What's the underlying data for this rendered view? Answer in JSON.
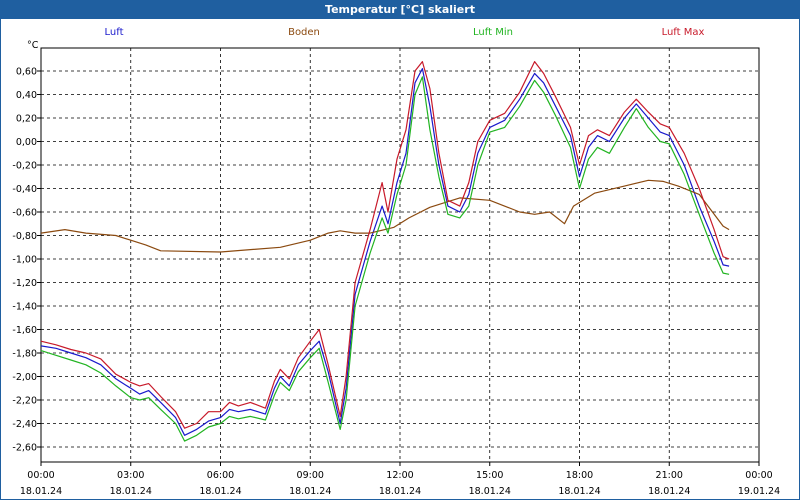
{
  "window": {
    "title": "Temperatur [°C] skaliert"
  },
  "chart_data": {
    "type": "line",
    "title": "Temperatur [°C] skaliert",
    "ylabel": "°C",
    "ylim": [
      -2.75,
      0.8
    ],
    "y_ticks": [
      "0,60",
      "0,40",
      "0,20",
      "0,00",
      "-0,20",
      "-0,40",
      "-0,60",
      "-0,80",
      "-1,00",
      "-1,20",
      "-1,40",
      "-1,60",
      "-1,80",
      "-2,00",
      "-2,20",
      "-2,40",
      "-2,60"
    ],
    "y_tick_values": [
      0.6,
      0.4,
      0.2,
      0,
      -0.2,
      -0.4,
      -0.6,
      -0.8,
      -1.0,
      -1.2,
      -1.4,
      -1.6,
      -1.8,
      -2.0,
      -2.2,
      -2.4,
      -2.6
    ],
    "x_ticks": [
      {
        "time": "00:00",
        "date": "18.01.24",
        "hour": 0
      },
      {
        "time": "03:00",
        "date": "18.01.24",
        "hour": 3
      },
      {
        "time": "06:00",
        "date": "18.01.24",
        "hour": 6
      },
      {
        "time": "09:00",
        "date": "18.01.24",
        "hour": 9
      },
      {
        "time": "12:00",
        "date": "18.01.24",
        "hour": 12
      },
      {
        "time": "15:00",
        "date": "18.01.24",
        "hour": 15
      },
      {
        "time": "18:00",
        "date": "18.01.24",
        "hour": 18
      },
      {
        "time": "21:00",
        "date": "18.01.24",
        "hour": 21
      },
      {
        "time": "00:00",
        "date": "19.01.24",
        "hour": 24
      }
    ],
    "x_range_hours": [
      0,
      24
    ],
    "grid": true,
    "legend_position": "top",
    "series": [
      {
        "name": "Luft",
        "color": "#1a1acc",
        "points": [
          [
            0,
            -1.74
          ],
          [
            0.5,
            -1.76
          ],
          [
            1,
            -1.8
          ],
          [
            1.5,
            -1.84
          ],
          [
            2,
            -1.9
          ],
          [
            2.5,
            -2.02
          ],
          [
            3,
            -2.1
          ],
          [
            3.3,
            -2.15
          ],
          [
            3.6,
            -2.12
          ],
          [
            4,
            -2.22
          ],
          [
            4.5,
            -2.35
          ],
          [
            4.8,
            -2.5
          ],
          [
            5.2,
            -2.45
          ],
          [
            5.6,
            -2.38
          ],
          [
            6,
            -2.35
          ],
          [
            6.3,
            -2.28
          ],
          [
            6.6,
            -2.3
          ],
          [
            7,
            -2.28
          ],
          [
            7.5,
            -2.32
          ],
          [
            7.8,
            -2.1
          ],
          [
            8,
            -2.0
          ],
          [
            8.3,
            -2.08
          ],
          [
            8.6,
            -1.9
          ],
          [
            9,
            -1.78
          ],
          [
            9.3,
            -1.7
          ],
          [
            9.6,
            -1.96
          ],
          [
            10,
            -2.4
          ],
          [
            10.2,
            -2.1
          ],
          [
            10.5,
            -1.3
          ],
          [
            11,
            -0.85
          ],
          [
            11.4,
            -0.55
          ],
          [
            11.6,
            -0.7
          ],
          [
            11.9,
            -0.35
          ],
          [
            12.2,
            -0.1
          ],
          [
            12.5,
            0.5
          ],
          [
            12.75,
            0.62
          ],
          [
            13,
            0.3
          ],
          [
            13.3,
            -0.2
          ],
          [
            13.6,
            -0.55
          ],
          [
            14,
            -0.6
          ],
          [
            14.3,
            -0.45
          ],
          [
            14.6,
            -0.1
          ],
          [
            15,
            0.12
          ],
          [
            15.5,
            0.18
          ],
          [
            16,
            0.36
          ],
          [
            16.5,
            0.58
          ],
          [
            16.8,
            0.5
          ],
          [
            17.2,
            0.3
          ],
          [
            17.7,
            0.05
          ],
          [
            18,
            -0.3
          ],
          [
            18.3,
            -0.05
          ],
          [
            18.6,
            0.05
          ],
          [
            19,
            0.0
          ],
          [
            19.5,
            0.2
          ],
          [
            19.9,
            0.32
          ],
          [
            20.3,
            0.2
          ],
          [
            20.7,
            0.08
          ],
          [
            21,
            0.05
          ],
          [
            21.5,
            -0.2
          ],
          [
            22,
            -0.55
          ],
          [
            22.5,
            -0.85
          ],
          [
            22.8,
            -1.05
          ],
          [
            23,
            -1.06
          ]
        ]
      },
      {
        "name": "Boden",
        "color": "#8b4a10",
        "points": [
          [
            0,
            -0.78
          ],
          [
            0.8,
            -0.75
          ],
          [
            1.5,
            -0.78
          ],
          [
            2.5,
            -0.8
          ],
          [
            3.5,
            -0.88
          ],
          [
            4,
            -0.93
          ],
          [
            6,
            -0.94
          ],
          [
            8,
            -0.9
          ],
          [
            9,
            -0.84
          ],
          [
            9.6,
            -0.78
          ],
          [
            10,
            -0.76
          ],
          [
            10.5,
            -0.78
          ],
          [
            11,
            -0.78
          ],
          [
            11.8,
            -0.73
          ],
          [
            12.3,
            -0.65
          ],
          [
            13,
            -0.56
          ],
          [
            13.5,
            -0.52
          ],
          [
            14,
            -0.48
          ],
          [
            15,
            -0.5
          ],
          [
            15.6,
            -0.56
          ],
          [
            16,
            -0.6
          ],
          [
            16.5,
            -0.62
          ],
          [
            17,
            -0.6
          ],
          [
            17.5,
            -0.7
          ],
          [
            17.8,
            -0.55
          ],
          [
            18.5,
            -0.44
          ],
          [
            19.5,
            -0.38
          ],
          [
            20.3,
            -0.33
          ],
          [
            20.8,
            -0.34
          ],
          [
            21.3,
            -0.38
          ],
          [
            22,
            -0.45
          ],
          [
            22.8,
            -0.72
          ],
          [
            23,
            -0.75
          ]
        ]
      },
      {
        "name": "Luft Min",
        "color": "#22b422",
        "points": [
          [
            0,
            -1.78
          ],
          [
            0.5,
            -1.82
          ],
          [
            1,
            -1.86
          ],
          [
            1.5,
            -1.9
          ],
          [
            2,
            -1.97
          ],
          [
            2.5,
            -2.08
          ],
          [
            3,
            -2.18
          ],
          [
            3.3,
            -2.2
          ],
          [
            3.6,
            -2.18
          ],
          [
            4,
            -2.28
          ],
          [
            4.5,
            -2.4
          ],
          [
            4.8,
            -2.55
          ],
          [
            5.2,
            -2.5
          ],
          [
            5.6,
            -2.43
          ],
          [
            6,
            -2.4
          ],
          [
            6.3,
            -2.34
          ],
          [
            6.6,
            -2.36
          ],
          [
            7,
            -2.34
          ],
          [
            7.5,
            -2.37
          ],
          [
            7.8,
            -2.16
          ],
          [
            8,
            -2.05
          ],
          [
            8.3,
            -2.12
          ],
          [
            8.6,
            -1.96
          ],
          [
            9,
            -1.84
          ],
          [
            9.3,
            -1.76
          ],
          [
            9.6,
            -2.05
          ],
          [
            10,
            -2.45
          ],
          [
            10.2,
            -2.2
          ],
          [
            10.5,
            -1.4
          ],
          [
            11,
            -0.95
          ],
          [
            11.4,
            -0.65
          ],
          [
            11.6,
            -0.78
          ],
          [
            11.9,
            -0.45
          ],
          [
            12.2,
            -0.2
          ],
          [
            12.5,
            0.4
          ],
          [
            12.75,
            0.55
          ],
          [
            13,
            0.1
          ],
          [
            13.3,
            -0.3
          ],
          [
            13.6,
            -0.62
          ],
          [
            14,
            -0.65
          ],
          [
            14.3,
            -0.55
          ],
          [
            14.6,
            -0.2
          ],
          [
            15,
            0.08
          ],
          [
            15.5,
            0.12
          ],
          [
            16,
            0.3
          ],
          [
            16.5,
            0.52
          ],
          [
            16.8,
            0.42
          ],
          [
            17.2,
            0.22
          ],
          [
            17.7,
            -0.05
          ],
          [
            18,
            -0.4
          ],
          [
            18.3,
            -0.15
          ],
          [
            18.6,
            -0.05
          ],
          [
            19,
            -0.1
          ],
          [
            19.5,
            0.12
          ],
          [
            19.9,
            0.28
          ],
          [
            20.3,
            0.12
          ],
          [
            20.7,
            0.0
          ],
          [
            21,
            -0.02
          ],
          [
            21.5,
            -0.28
          ],
          [
            22,
            -0.62
          ],
          [
            22.5,
            -0.95
          ],
          [
            22.8,
            -1.12
          ],
          [
            23,
            -1.13
          ]
        ]
      },
      {
        "name": "Luft Max",
        "color": "#c81a2a",
        "points": [
          [
            0,
            -1.7
          ],
          [
            0.5,
            -1.73
          ],
          [
            1,
            -1.77
          ],
          [
            1.5,
            -1.8
          ],
          [
            2,
            -1.85
          ],
          [
            2.5,
            -1.98
          ],
          [
            3,
            -2.05
          ],
          [
            3.3,
            -2.08
          ],
          [
            3.6,
            -2.06
          ],
          [
            4,
            -2.17
          ],
          [
            4.5,
            -2.3
          ],
          [
            4.8,
            -2.44
          ],
          [
            5.2,
            -2.4
          ],
          [
            5.6,
            -2.3
          ],
          [
            6,
            -2.3
          ],
          [
            6.3,
            -2.22
          ],
          [
            6.6,
            -2.25
          ],
          [
            7,
            -2.22
          ],
          [
            7.5,
            -2.27
          ],
          [
            7.8,
            -2.04
          ],
          [
            8,
            -1.94
          ],
          [
            8.3,
            -2.02
          ],
          [
            8.6,
            -1.84
          ],
          [
            9,
            -1.7
          ],
          [
            9.3,
            -1.6
          ],
          [
            9.6,
            -1.9
          ],
          [
            10,
            -2.34
          ],
          [
            10.2,
            -2.0
          ],
          [
            10.5,
            -1.2
          ],
          [
            11,
            -0.75
          ],
          [
            11.4,
            -0.35
          ],
          [
            11.6,
            -0.6
          ],
          [
            11.9,
            -0.15
          ],
          [
            12.2,
            0.1
          ],
          [
            12.5,
            0.6
          ],
          [
            12.75,
            0.68
          ],
          [
            13,
            0.45
          ],
          [
            13.3,
            -0.1
          ],
          [
            13.6,
            -0.5
          ],
          [
            14,
            -0.55
          ],
          [
            14.3,
            -0.35
          ],
          [
            14.6,
            0.0
          ],
          [
            15,
            0.18
          ],
          [
            15.5,
            0.24
          ],
          [
            16,
            0.42
          ],
          [
            16.5,
            0.68
          ],
          [
            16.8,
            0.58
          ],
          [
            17.2,
            0.38
          ],
          [
            17.7,
            0.12
          ],
          [
            18,
            -0.2
          ],
          [
            18.3,
            0.05
          ],
          [
            18.6,
            0.1
          ],
          [
            19,
            0.05
          ],
          [
            19.5,
            0.25
          ],
          [
            19.9,
            0.36
          ],
          [
            20.3,
            0.25
          ],
          [
            20.7,
            0.15
          ],
          [
            21,
            0.12
          ],
          [
            21.5,
            -0.1
          ],
          [
            22,
            -0.4
          ],
          [
            22.5,
            -0.75
          ],
          [
            22.8,
            -0.98
          ],
          [
            23,
            -1.0
          ]
        ]
      }
    ]
  }
}
